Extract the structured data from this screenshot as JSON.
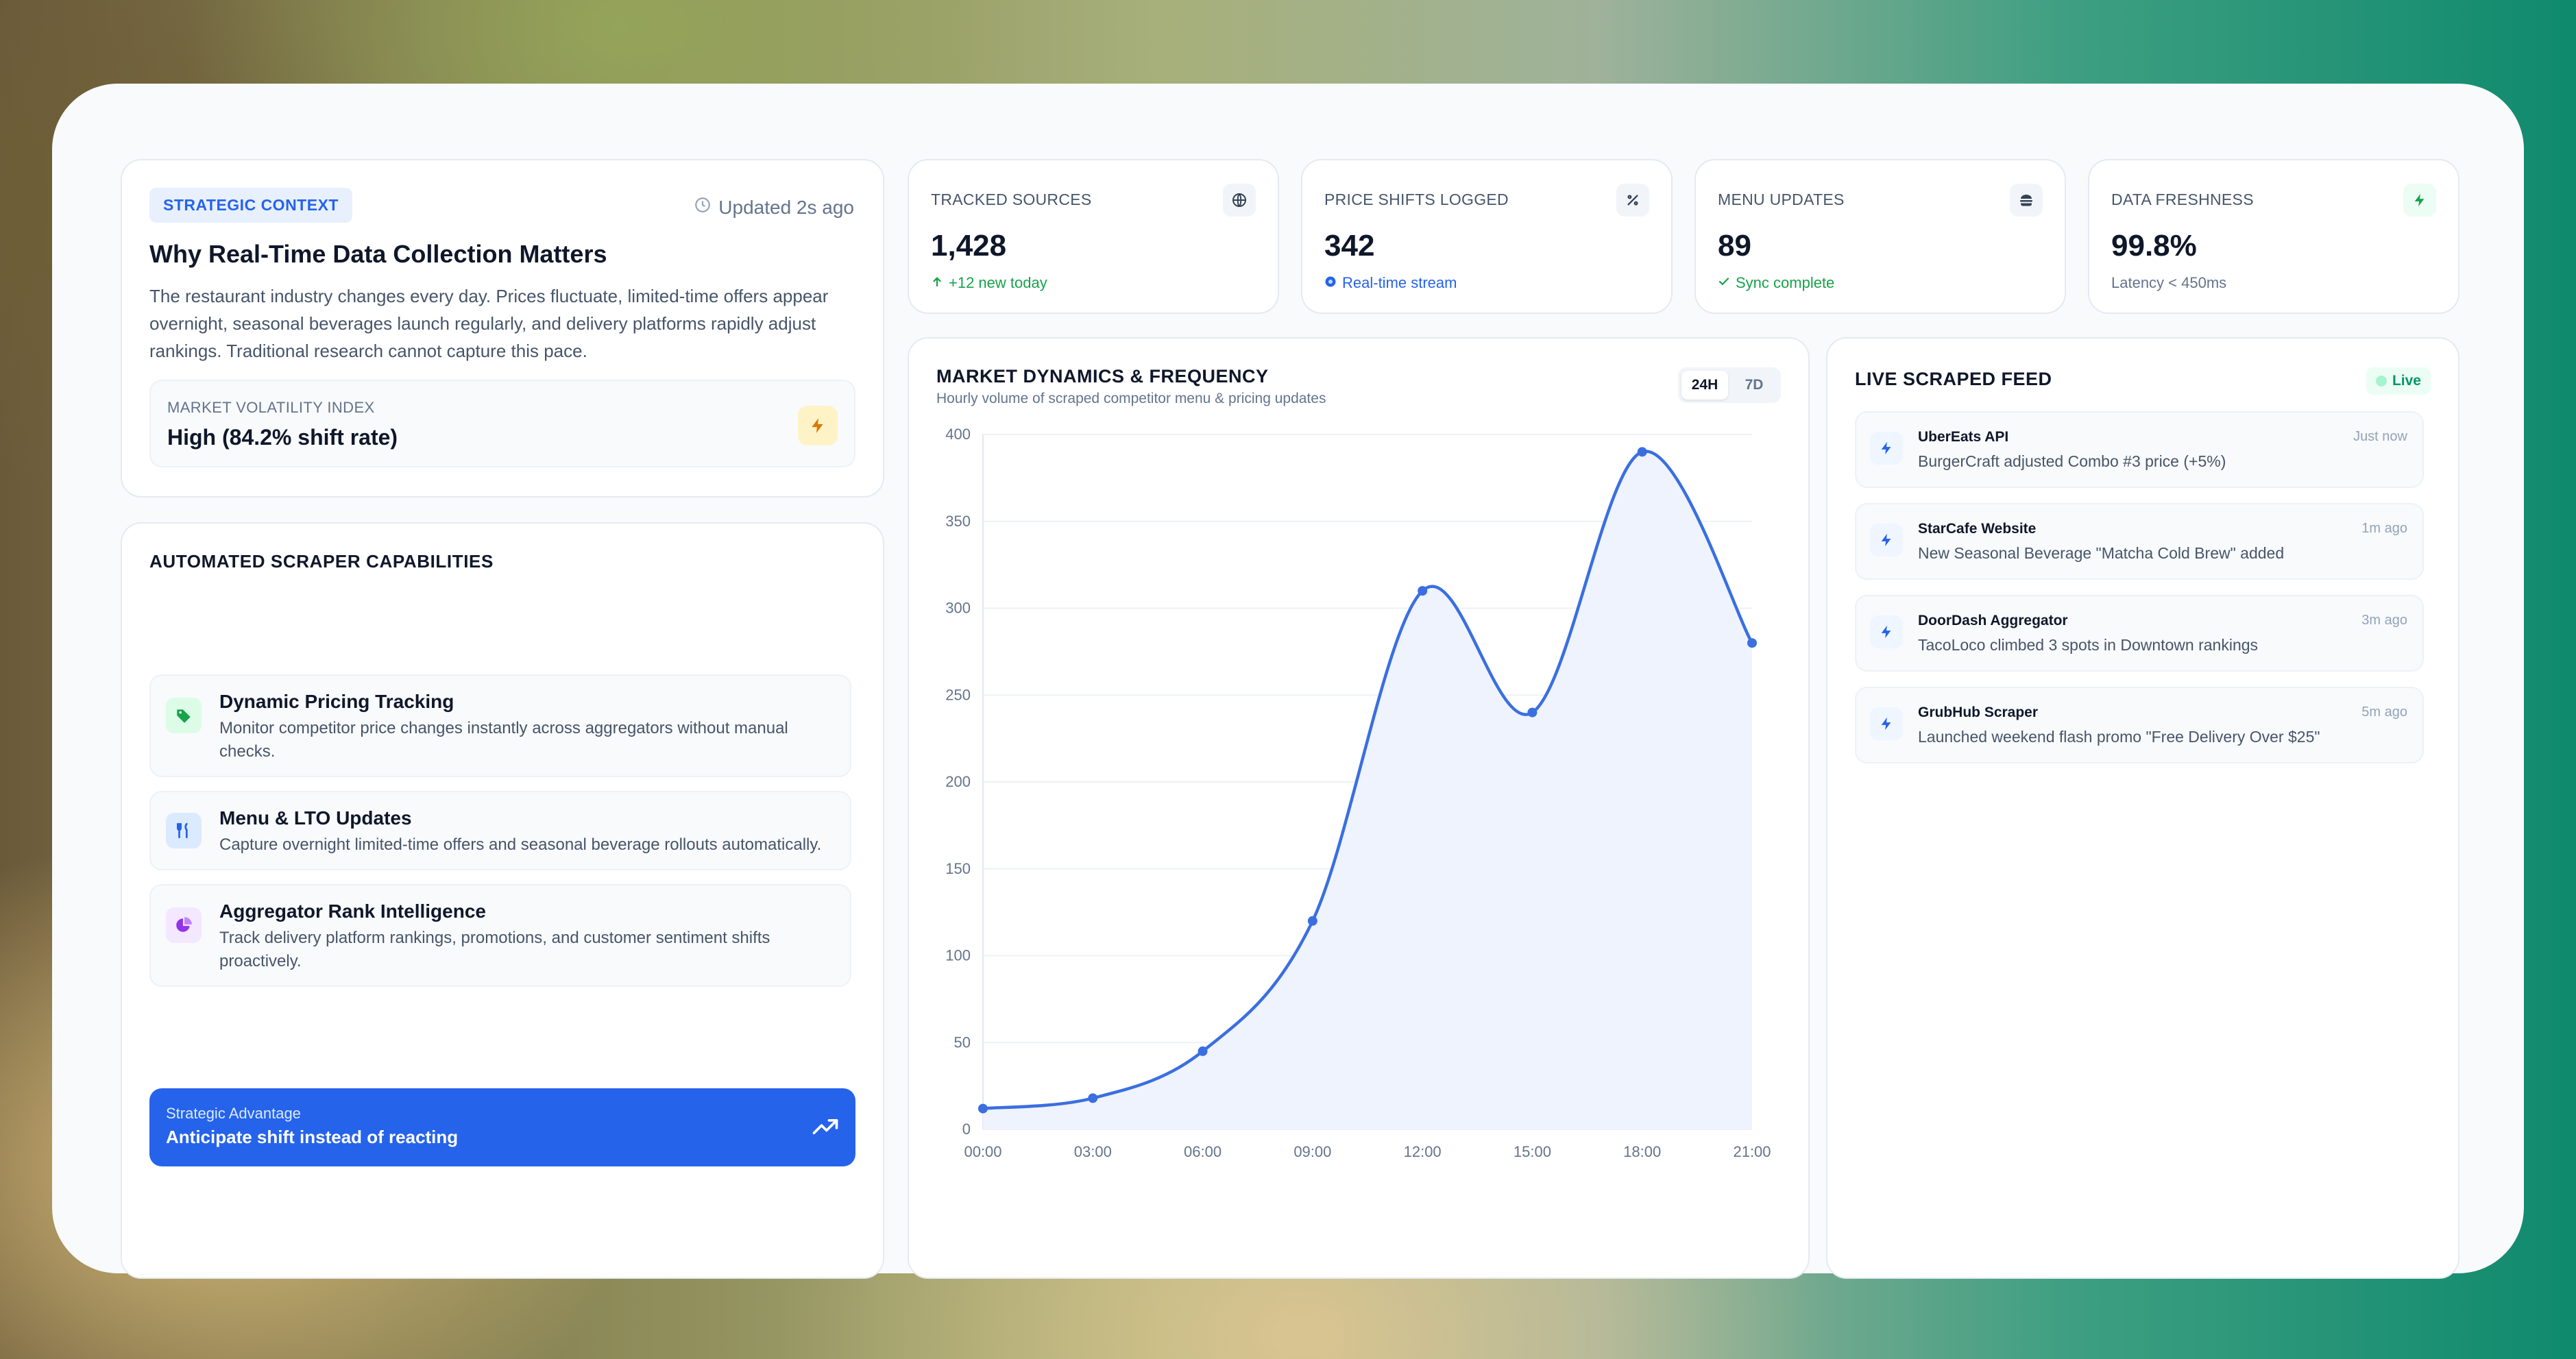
{
  "context": {
    "pill": "STRATEGIC CONTEXT",
    "updated": "Updated 2s ago",
    "title": "Why Real-Time Data Collection Matters",
    "description": "The restaurant industry changes every day. Prices fluctuate, limited-time offers appear overnight, seasonal beverages launch regularly, and delivery platforms rapidly adjust rankings. Traditional research cannot capture this pace.",
    "volatility_label": "MARKET VOLATILITY INDEX",
    "volatility_value": "High (84.2% shift rate)",
    "volatility_icon": "bolt-icon"
  },
  "capabilities": {
    "title": "AUTOMATED SCRAPER CAPABILITIES",
    "items": [
      {
        "name": "Dynamic Pricing Tracking",
        "desc": "Monitor competitor price changes instantly across aggregators without manual checks.",
        "icon": "tag-icon",
        "color": "#16a34a",
        "bg": "#dcfce7"
      },
      {
        "name": "Menu & LTO Updates",
        "desc": "Capture overnight limited-time offers and seasonal beverage rollouts automatically.",
        "icon": "utensils-icon",
        "color": "#2563eb",
        "bg": "#dbeafe"
      },
      {
        "name": "Aggregator Rank Intelligence",
        "desc": "Track delivery platform rankings, promotions, and customer sentiment shifts proactively.",
        "icon": "pie-chart-icon",
        "color": "#9333ea",
        "bg": "#f3e8ff"
      }
    ],
    "advantage_label": "Strategic Advantage",
    "advantage_value": "Anticipate shift instead of reacting"
  },
  "stats": [
    {
      "label": "TRACKED SOURCES",
      "value": "1,428",
      "sub": "+12 new today",
      "sub_color": "#16a34a",
      "icon": "globe-icon"
    },
    {
      "label": "PRICE SHIFTS LOGGED",
      "value": "342",
      "sub": "Real-time stream",
      "sub_color": "#2563eb",
      "icon": "percent-icon"
    },
    {
      "label": "MENU UPDATES",
      "value": "89",
      "sub": "Sync complete",
      "sub_color": "#16a34a",
      "icon": "burger-icon"
    },
    {
      "label": "DATA FRESHNESS",
      "value": "99.8%",
      "sub": "Latency < 450ms",
      "sub_color": "#64748b",
      "icon": "bolt-icon"
    }
  ],
  "chart": {
    "title": "MARKET DYNAMICS & FREQUENCY",
    "subtitle": "Hourly volume of scraped competitor menu & pricing updates",
    "ranges": [
      "24H",
      "7D"
    ],
    "active_range": "24H"
  },
  "chart_data": {
    "type": "line",
    "x": [
      "00:00",
      "03:00",
      "06:00",
      "09:00",
      "12:00",
      "15:00",
      "18:00",
      "21:00"
    ],
    "series": [
      {
        "values": [
          12,
          18,
          45,
          120,
          310,
          240,
          390,
          280
        ]
      }
    ],
    "ylim": [
      0,
      400
    ],
    "yticks": [
      0,
      50,
      100,
      150,
      200,
      250,
      300,
      350,
      400
    ],
    "color": "#3b6fe0",
    "grid": true
  },
  "feed": {
    "title": "LIVE SCRAPED FEED",
    "live_label": "Live",
    "items": [
      {
        "source": "UberEats API",
        "message": "BurgerCraft adjusted Combo #3 price (+5%)",
        "time": "Just now"
      },
      {
        "source": "StarCafe Website",
        "message": "New Seasonal Beverage \"Matcha Cold Brew\" added",
        "time": "1m ago"
      },
      {
        "source": "DoorDash Aggregator",
        "message": "TacoLoco climbed 3 spots in Downtown rankings",
        "time": "3m ago"
      },
      {
        "source": "GrubHub Scraper",
        "message": "Launched weekend flash promo \"Free Delivery Over $25\"",
        "time": "5m ago"
      }
    ]
  }
}
